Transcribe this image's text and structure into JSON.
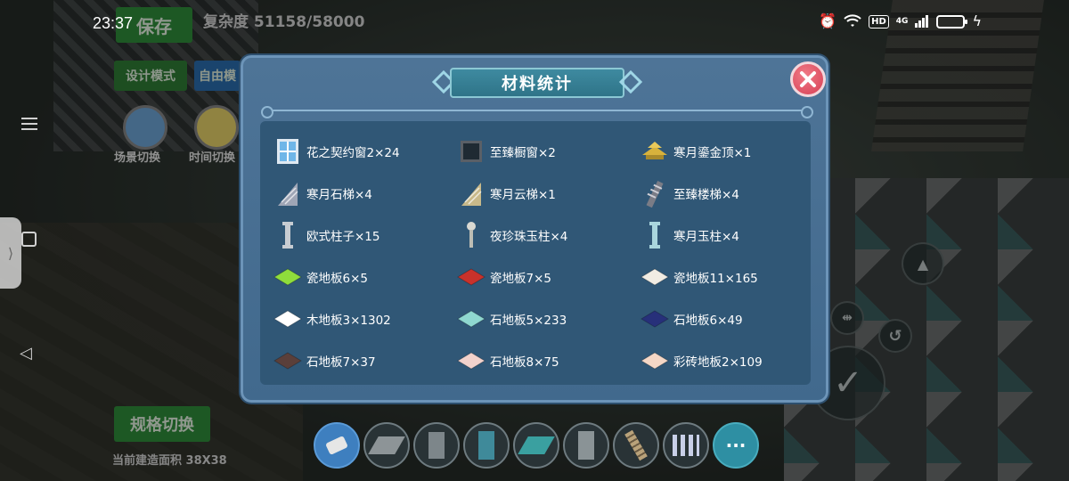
{
  "status_bar": {
    "time": "23:37",
    "hd_badge": "HD",
    "network": "4G"
  },
  "hud": {
    "save_label": "保存",
    "complexity": "复杂度 51158/58000",
    "mode_design": "设计模式",
    "mode_free": "自由模",
    "scene_switch": "场景切换",
    "time_switch": "时间切换",
    "spec_switch": "规格切换",
    "build_area": "当前建造面积 38X38"
  },
  "dialog": {
    "title": "材料统计",
    "items": [
      {
        "label": "花之契约窗2×24",
        "icon": "window-icon",
        "color": "#6fb6e8"
      },
      {
        "label": "至臻橱窗×2",
        "icon": "cabinet-window-icon",
        "color": "#1f2a33"
      },
      {
        "label": "寒月鎏金顶×1",
        "icon": "golden-roof-icon",
        "color": "#d7b23c"
      },
      {
        "label": "寒月石梯×4",
        "icon": "stone-stairs-icon",
        "color": "#9fa6b6"
      },
      {
        "label": "寒月云梯×1",
        "icon": "cloud-ladder-icon",
        "color": "#c8b98a"
      },
      {
        "label": "至臻楼梯×4",
        "icon": "staircase-icon",
        "color": "#7a7c86"
      },
      {
        "label": "欧式柱子×15",
        "icon": "european-pillar-icon",
        "color": "#c7ccd2"
      },
      {
        "label": "夜珍珠玉柱×4",
        "icon": "pearl-jade-pillar-icon",
        "color": "#d9d9d2"
      },
      {
        "label": "寒月玉柱×4",
        "icon": "jade-pillar-icon",
        "color": "#a9d6dd"
      },
      {
        "label": "瓷地板6×5",
        "icon": "floor-tile-icon",
        "color": "#8fdd3c"
      },
      {
        "label": "瓷地板7×5",
        "icon": "floor-tile-icon",
        "color": "#c9322b"
      },
      {
        "label": "瓷地板11×165",
        "icon": "floor-tile-icon",
        "color": "#f1ece3"
      },
      {
        "label": "木地板3×1302",
        "icon": "floor-tile-icon",
        "color": "#ffffff"
      },
      {
        "label": "石地板5×233",
        "icon": "floor-tile-icon",
        "color": "#8fd8d0"
      },
      {
        "label": "石地板6×49",
        "icon": "floor-tile-icon",
        "color": "#27307a"
      },
      {
        "label": "石地板7×37",
        "icon": "floor-tile-icon",
        "color": "#5a3f3a"
      },
      {
        "label": "石地板8×75",
        "icon": "floor-tile-icon",
        "color": "#f2d2cc"
      },
      {
        "label": "彩砖地板2×109",
        "icon": "floor-tile-icon",
        "color": "#f4d7c6"
      }
    ]
  }
}
